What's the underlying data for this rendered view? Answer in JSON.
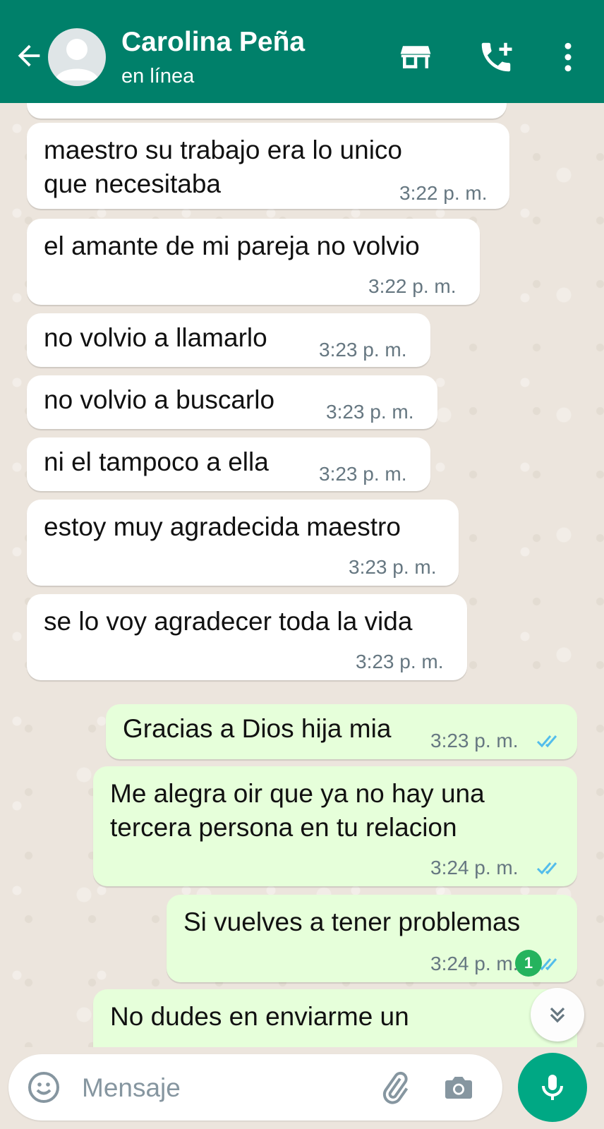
{
  "header": {
    "contact_name": "Carolina Peña",
    "status": "en línea"
  },
  "messages": [
    {
      "dir": "in",
      "lines": [
        "maestro su trabajo era lo unico",
        "que necesitaba"
      ],
      "time": "3:22 p. m."
    },
    {
      "dir": "in",
      "lines": [
        "el amante de mi pareja no volvio"
      ],
      "time": "3:22 p. m."
    },
    {
      "dir": "in",
      "lines": [
        "no volvio a llamarlo"
      ],
      "time": "3:23 p. m."
    },
    {
      "dir": "in",
      "lines": [
        "no volvio a buscarlo"
      ],
      "time": "3:23 p. m."
    },
    {
      "dir": "in",
      "lines": [
        "ni el tampoco a ella"
      ],
      "time": "3:23 p. m."
    },
    {
      "dir": "in",
      "lines": [
        "estoy muy agradecida maestro"
      ],
      "time": "3:23 p. m."
    },
    {
      "dir": "in",
      "lines": [
        "se lo voy agradecer toda la vida"
      ],
      "time": "3:23 p. m."
    },
    {
      "dir": "out",
      "lines": [
        "Gracias a Dios hija mia"
      ],
      "time": "3:23 p. m.",
      "status": "read"
    },
    {
      "dir": "out",
      "lines": [
        "Me alegra oir que ya no hay una",
        "tercera persona en tu relacion"
      ],
      "time": "3:24 p. m.",
      "status": "read"
    },
    {
      "dir": "out",
      "lines": [
        "Si vuelves a tener problemas"
      ],
      "time": "3:24 p. m.",
      "status": "read"
    },
    {
      "dir": "out",
      "lines": [
        "No dudes en enviarme un"
      ],
      "time": ""
    }
  ],
  "unread_count": "1",
  "composer": {
    "placeholder": "Mensaje"
  },
  "colors": {
    "header": "#00806a",
    "incoming_bubble": "#ffffff",
    "outgoing_bubble": "#e6ffda",
    "read_ticks": "#53bdeb",
    "send_button": "#00a884",
    "unread_badge": "#25b35e"
  },
  "icons": [
    "back-arrow-icon",
    "avatar-placeholder-icon",
    "store-icon",
    "add-call-icon",
    "more-vert-icon",
    "double-check-icon",
    "chevron-double-down-icon",
    "emoji-icon",
    "attach-icon",
    "camera-icon",
    "mic-icon"
  ]
}
